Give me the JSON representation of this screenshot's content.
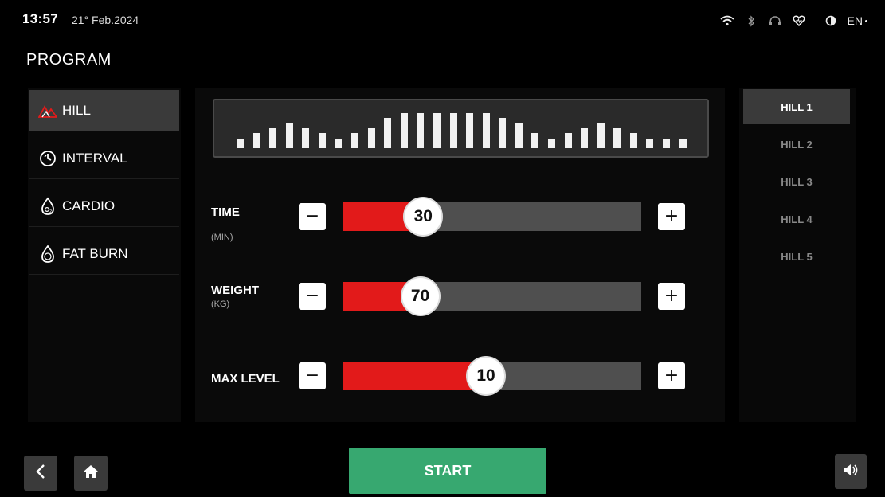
{
  "status": {
    "time": "13:57",
    "date": "21° Feb.2024",
    "language": "EN"
  },
  "icons": [
    "wifi-icon",
    "bluetooth-icon",
    "headphones-icon",
    "heart-icon",
    "brightness-icon",
    "back-icon",
    "home-icon",
    "volume-icon"
  ],
  "page": {
    "title": "PROGRAM"
  },
  "programs": [
    {
      "label": "HILL",
      "icon": "mountain-icon",
      "active": true
    },
    {
      "label": "INTERVAL",
      "icon": "stopwatch-icon",
      "active": false
    },
    {
      "label": "CARDIO",
      "icon": "o2-drop-icon",
      "active": false
    },
    {
      "label": "FAT BURN",
      "icon": "fat-drop-icon",
      "active": false
    }
  ],
  "profile_levels": [
    1,
    2,
    3,
    4,
    3,
    2,
    1,
    2,
    3,
    5,
    6,
    6,
    6,
    6,
    6,
    6,
    5,
    4,
    2,
    1,
    2,
    3,
    4,
    3,
    2,
    1,
    1,
    1
  ],
  "controls": {
    "time": {
      "label": "TIME",
      "unit": "(MIN)",
      "value": "30",
      "fill_percent": 27
    },
    "weight": {
      "label": "WEIGHT",
      "unit": "(KG)",
      "value": "70",
      "fill_percent": 26
    },
    "max_level": {
      "label": "MAX LEVEL",
      "value": "10",
      "fill_percent": 48
    }
  },
  "sub_programs": [
    {
      "label": "HILL 1",
      "active": true
    },
    {
      "label": "HILL 2",
      "active": false
    },
    {
      "label": "HILL 3",
      "active": false
    },
    {
      "label": "HILL 4",
      "active": false
    },
    {
      "label": "HILL 5",
      "active": false
    }
  ],
  "buttons": {
    "start": "START",
    "minus": "−",
    "plus": "+"
  },
  "colors": {
    "accent_red": "#e21a1a",
    "start_green": "#37a870",
    "active_gray": "#3a3a3a"
  }
}
